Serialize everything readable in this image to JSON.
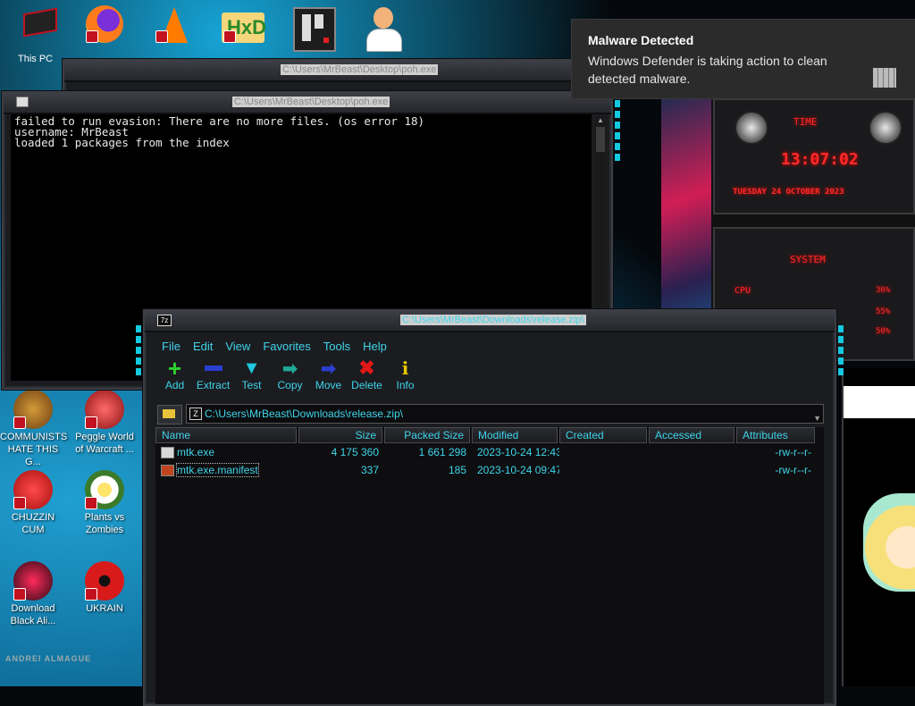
{
  "desktop": {
    "this_pc_label": "This PC",
    "icons": [
      {
        "label": "COMMUNISTS HATE THIS G..."
      },
      {
        "label": "Peggle World of Warcraft ..."
      },
      {
        "label": "CHUZZIN CUM"
      },
      {
        "label": "Plants vs Zombies"
      },
      {
        "label": "Download Black Ali..."
      },
      {
        "label": "UKRAIN"
      }
    ],
    "signature": "ANDREI ALMAGUE"
  },
  "back_window": {
    "title": "C:\\Users\\MrBeast\\Desktop\\poh.exe"
  },
  "terminal": {
    "title": "C:\\Users\\MrBeast\\Desktop\\poh.exe",
    "lines": [
      "failed to run evasion: There are no more files. (os error 18)",
      "username: MrBeast",
      "loaded 1 packages from the index"
    ]
  },
  "notification": {
    "title": "Malware Detected",
    "body": "Windows Defender is taking action to clean detected malware."
  },
  "widget": {
    "time_label": "TIME",
    "time": "13:07:02",
    "date": "TUESDAY 24 OCTOBER 2023",
    "system_label": "SYSTEM",
    "cpu_label": "CPU",
    "cpu_pct": "36%",
    "ram_pct": "55%",
    "disk_pct": "50%"
  },
  "sevenzip": {
    "title": "C:\\Users\\MrBeast\\Downloads\\release.zip\\",
    "menu": [
      "File",
      "Edit",
      "View",
      "Favorites",
      "Tools",
      "Help"
    ],
    "toolbar": [
      {
        "label": "Add",
        "icon": "plus-icon",
        "color": "#2ed12e"
      },
      {
        "label": "Extract",
        "icon": "minus-icon",
        "color": "#2a3fd0"
      },
      {
        "label": "Test",
        "icon": "check-icon",
        "color": "#20c8e0"
      },
      {
        "label": "Copy",
        "icon": "arrow-right-icon",
        "color": "#20a898"
      },
      {
        "label": "Move",
        "icon": "arrow-right-icon",
        "color": "#2a3fd0"
      },
      {
        "label": "Delete",
        "icon": "x-icon",
        "color": "#e01818"
      },
      {
        "label": "Info",
        "icon": "info-icon",
        "color": "#e8c800"
      }
    ],
    "path": "C:\\Users\\MrBeast\\Downloads\\release.zip\\",
    "columns": [
      "Name",
      "Size",
      "Packed Size",
      "Modified",
      "Created",
      "Accessed",
      "Attributes"
    ],
    "files": [
      {
        "name": "mtk.exe",
        "size": "4 175 360",
        "packed": "1 661 298",
        "modified": "2023-10-24 12:43",
        "created": "",
        "accessed": "",
        "attributes": "-rw-r--r-"
      },
      {
        "name": "mtk.exe.manifest",
        "size": "337",
        "packed": "185",
        "modified": "2023-10-24 09:47",
        "created": "",
        "accessed": "",
        "attributes": "-rw-r--r-"
      }
    ]
  },
  "colors": {
    "accent": "#3fd4ea",
    "frame": "#3c3e45",
    "alert_red": "#ff2a2a"
  }
}
